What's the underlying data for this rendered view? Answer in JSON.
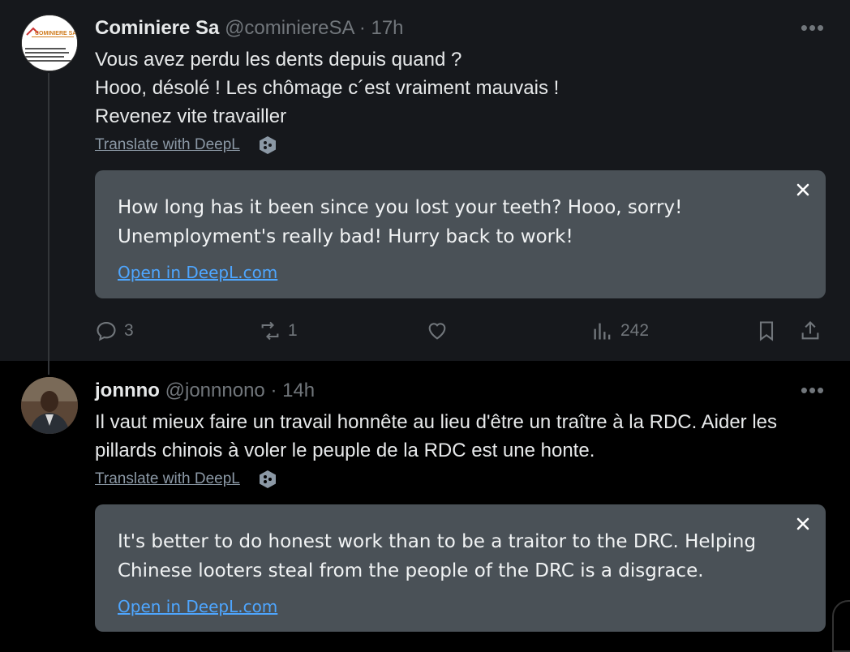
{
  "tweets": [
    {
      "display_name": "Cominiere Sa",
      "handle": "@cominiereSA",
      "time": "· 17h",
      "avatar_text": "COMINIERE SA",
      "lines": [
        "Vous avez perdu les dents depuis quand ?",
        "Hooo, désolé ! Les chômage c´est vraiment mauvais !",
        "Revenez vite travailler"
      ],
      "translate_label": "Translate with DeepL",
      "translation": "How long has it been since you lost your teeth? Hooo, sorry! Unemployment's really bad! Hurry back to work!",
      "open_link": "Open in DeepL.com",
      "replies": "3",
      "reposts": "1",
      "views": "242"
    },
    {
      "display_name": "jonnno",
      "handle": "@jonnnono",
      "time": "· 14h",
      "text": "Il vaut mieux faire un travail honnête au lieu d'être un traître à la RDC. Aider les pillards chinois à voler le peuple de la RDC est une honte.",
      "translate_label": "Translate with DeepL",
      "translation": "It's better to do honest work than to be a traitor to the DRC. Helping Chinese looters steal from the people of the DRC is a disgrace.",
      "open_link": "Open in DeepL.com"
    }
  ],
  "colors": {
    "background": "#000000",
    "tweet_highlight": "#16181c",
    "text_primary": "#e7e9ea",
    "text_secondary": "#71767b",
    "translation_box": "#4a5157",
    "link": "#4ea6ff"
  },
  "icons": [
    "reply-icon",
    "repost-icon",
    "like-icon",
    "views-icon",
    "bookmark-icon",
    "share-icon",
    "close-icon",
    "more-icon",
    "deepl-icon"
  ]
}
